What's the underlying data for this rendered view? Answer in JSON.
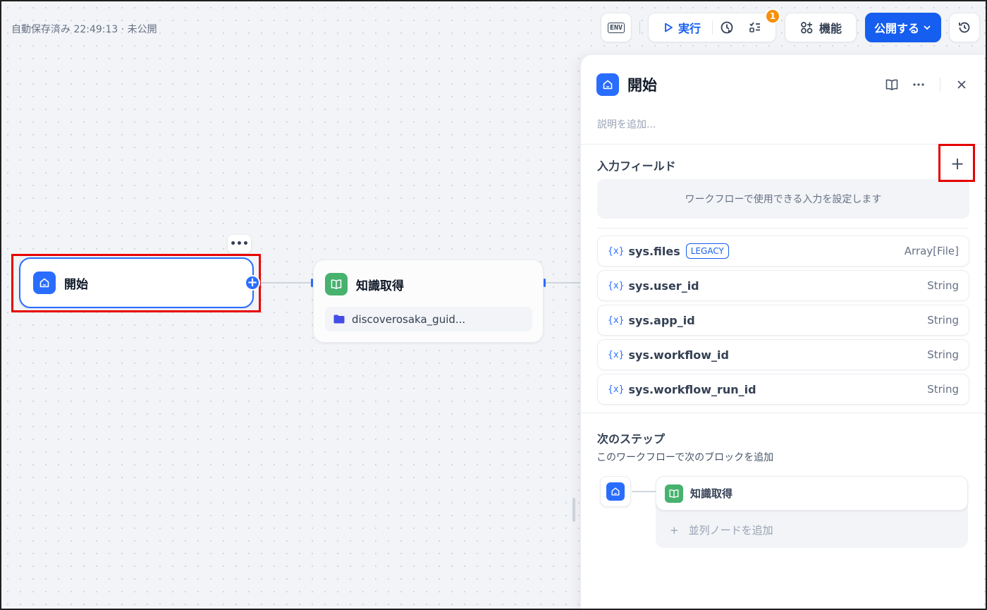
{
  "header": {
    "autosave_text": "自動保存済み 22:49:13 · 未公開",
    "env_label": "ENV",
    "run_label": "実行",
    "checklist_badge": "1",
    "features_label": "機能",
    "publish_label": "公開する"
  },
  "canvas": {
    "start_node": {
      "title": "開始",
      "more": "•••",
      "add": "+"
    },
    "knowledge_node": {
      "title": "知識取得",
      "dataset": "discoverosaka_guid..."
    }
  },
  "panel": {
    "title": "開始",
    "description_placeholder": "説明を追加...",
    "input_fields_title": "入力フィールド",
    "add_field": "+",
    "empty_hint": "ワークフローで使用できる入力を設定します",
    "variables": [
      {
        "icon": "{x}",
        "name": "sys.files",
        "tag": "LEGACY",
        "type": "Array[File]"
      },
      {
        "icon": "{x}",
        "name": "sys.user_id",
        "type": "String"
      },
      {
        "icon": "{x}",
        "name": "sys.app_id",
        "type": "String"
      },
      {
        "icon": "{x}",
        "name": "sys.workflow_id",
        "type": "String"
      },
      {
        "icon": "{x}",
        "name": "sys.workflow_run_id",
        "type": "String"
      }
    ],
    "next_step": {
      "title": "次のステップ",
      "subtitle": "このワークフローで次のブロックを追加",
      "next_node": "知識取得",
      "add_parallel_icon": "+",
      "add_parallel_label": "並列ノードを追加"
    }
  },
  "colors": {
    "accent": "#155eef",
    "highlight": "#e60000",
    "knowledge": "#47b26e",
    "badge": "#f79009"
  }
}
